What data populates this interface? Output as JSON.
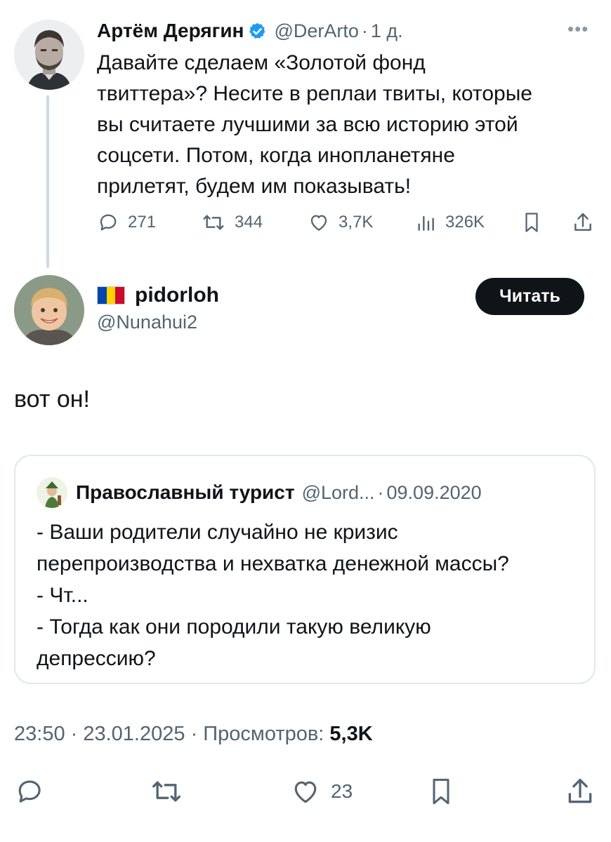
{
  "parent_tweet": {
    "author_name": "Артём Дерягин",
    "handle": "@DerArto",
    "time": "1 д.",
    "lines": [
      "Давайте сделаем «Золотой фонд",
      "твиттера»? Несите в реплаи твиты, которые",
      "вы считаете лучшими за всю историю этой",
      "соцсети. Потом, когда инопланетяне",
      "прилетят, будем им показывать!"
    ],
    "replies": "271",
    "retweets": "344",
    "likes": "3,7K",
    "views": "326K",
    "more_icon": "more-icon",
    "verified_color": "#1d9bf0"
  },
  "reply_tweet": {
    "display_name": "pidorloh",
    "handle": "@Nunahui2",
    "flag_icon": "moldova-flag-icon",
    "follow_label": "Читать",
    "text": "вот он!"
  },
  "quoted_tweet": {
    "author_name": "Православный турист",
    "handle": "@Lord...",
    "date": "09.09.2020",
    "lines": [
      "- Ваши родители случайно не кризис",
      "перепроизводства и нехватка денежной массы?",
      "- Чт...",
      "- Тогда как они породили такую великую",
      "депрессию?"
    ]
  },
  "meta": {
    "time": "23:50",
    "date": "23.01.2025",
    "views_label": "Просмотров:",
    "views_count": "5,3K"
  },
  "bottom_actions": {
    "likes": "23",
    "icons": [
      "reply-icon",
      "retweet-icon",
      "like-icon",
      "bookmark-icon",
      "share-icon"
    ]
  },
  "colors": {
    "text_primary": "#0f1419",
    "text_secondary": "#536471",
    "thread_line": "#cfd9de",
    "button_bg": "#0f1419"
  }
}
